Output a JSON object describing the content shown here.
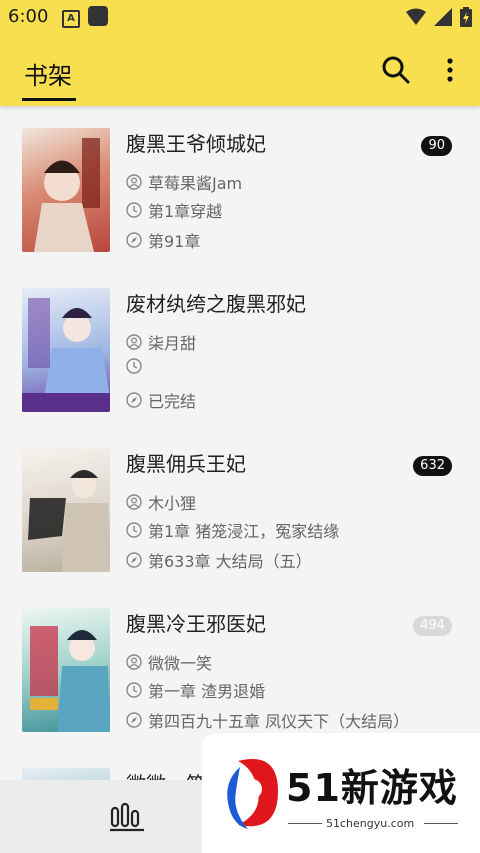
{
  "status": {
    "time": "6:00",
    "a_icon": "A"
  },
  "appbar": {
    "tab": "书架"
  },
  "books": [
    {
      "title": "腹黑王爷倾城妃",
      "author": "草莓果酱Jam",
      "last_read": "第1章穿越",
      "latest": "第91章",
      "badge": "90",
      "badge_style": "dark",
      "cover_color": "#b8463a"
    },
    {
      "title": "废材纨绔之腹黑邪妃",
      "author": "柒月甜",
      "last_read": "",
      "latest": "已完结",
      "badge": "",
      "badge_style": "none",
      "cover_color": "#6a3fa0"
    },
    {
      "title": "腹黑佣兵王妃",
      "author": "木小狸",
      "last_read": "第1章 猪笼浸江，冤家结缘",
      "latest": "第633章 大结局（五）",
      "badge": "632",
      "badge_style": "dark",
      "cover_color": "#d9d2c6"
    },
    {
      "title": "腹黑冷王邪医妃",
      "author": "微微一笑",
      "last_read": "第一章  渣男退婚",
      "latest": "第四百九十五章 凤仪天下（大结局）",
      "badge": "494",
      "badge_style": "muted",
      "cover_color": "#3f8f9a"
    },
    {
      "title": "微微一笑",
      "author": "",
      "last_read": "",
      "latest": "",
      "badge": "",
      "badge_style": "none",
      "cover_color": "#4a8fa8"
    }
  ],
  "watermark": {
    "text": "51新游戏",
    "url": "51chengyu.com"
  },
  "icons": {
    "search": "search-icon",
    "more": "more-vert-icon",
    "author": "person-icon",
    "time": "clock-icon",
    "latest": "compass-icon",
    "shelf": "bookshelf-icon"
  }
}
